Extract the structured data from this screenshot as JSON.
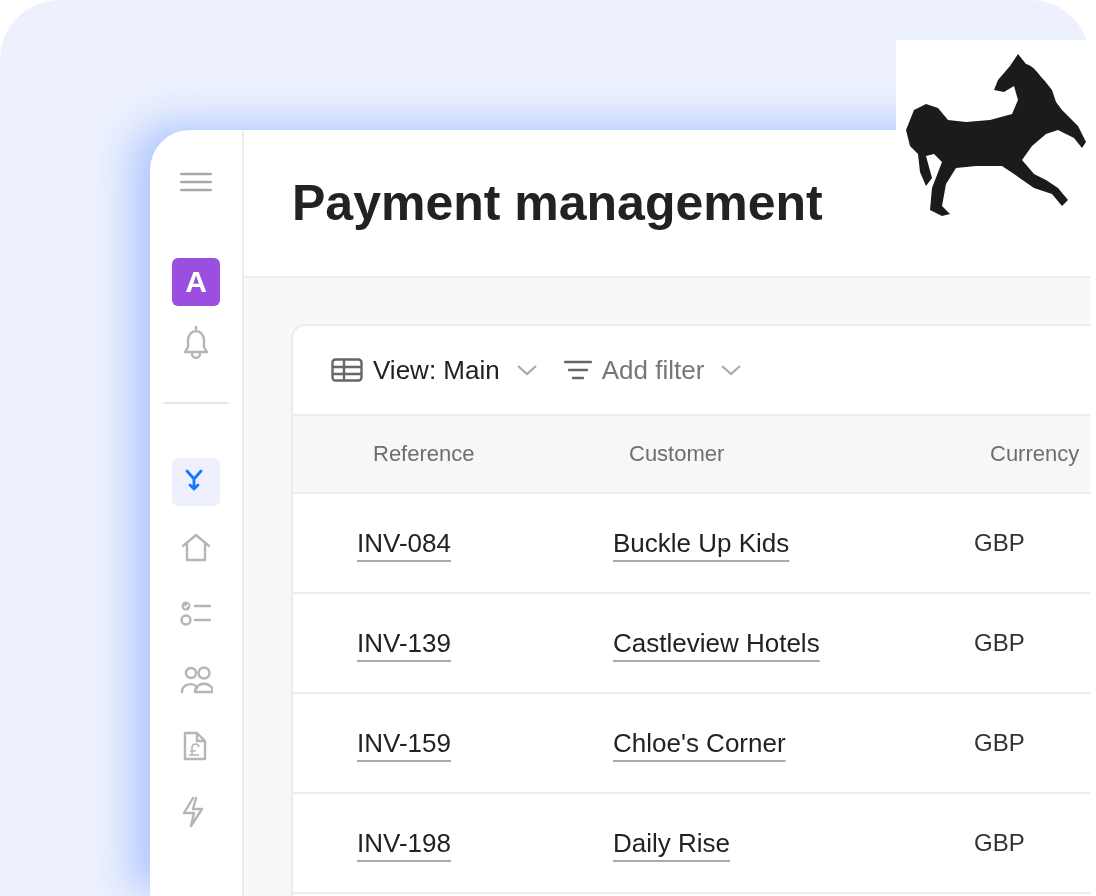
{
  "sidebar": {
    "avatar": "A",
    "nav_items": [
      {
        "selected": true
      },
      {
        "selected": false
      },
      {
        "selected": false
      },
      {
        "selected": false
      },
      {
        "selected": false
      },
      {
        "selected": false
      }
    ]
  },
  "header": {
    "title": "Payment management"
  },
  "toolbar": {
    "view": "View: Main",
    "filter": "Add filter"
  },
  "table": {
    "columns": [
      "Reference",
      "Customer",
      "Currency"
    ],
    "rows": [
      {
        "reference": "INV-084",
        "customer": "Buckle Up Kids",
        "currency": "GBP"
      },
      {
        "reference": "INV-139",
        "customer": "Castleview Hotels",
        "currency": "GBP"
      },
      {
        "reference": "INV-159",
        "customer": "Chloe's Corner",
        "currency": "GBP"
      },
      {
        "reference": "INV-198",
        "customer": "Daily Rise",
        "currency": "GBP"
      }
    ]
  }
}
